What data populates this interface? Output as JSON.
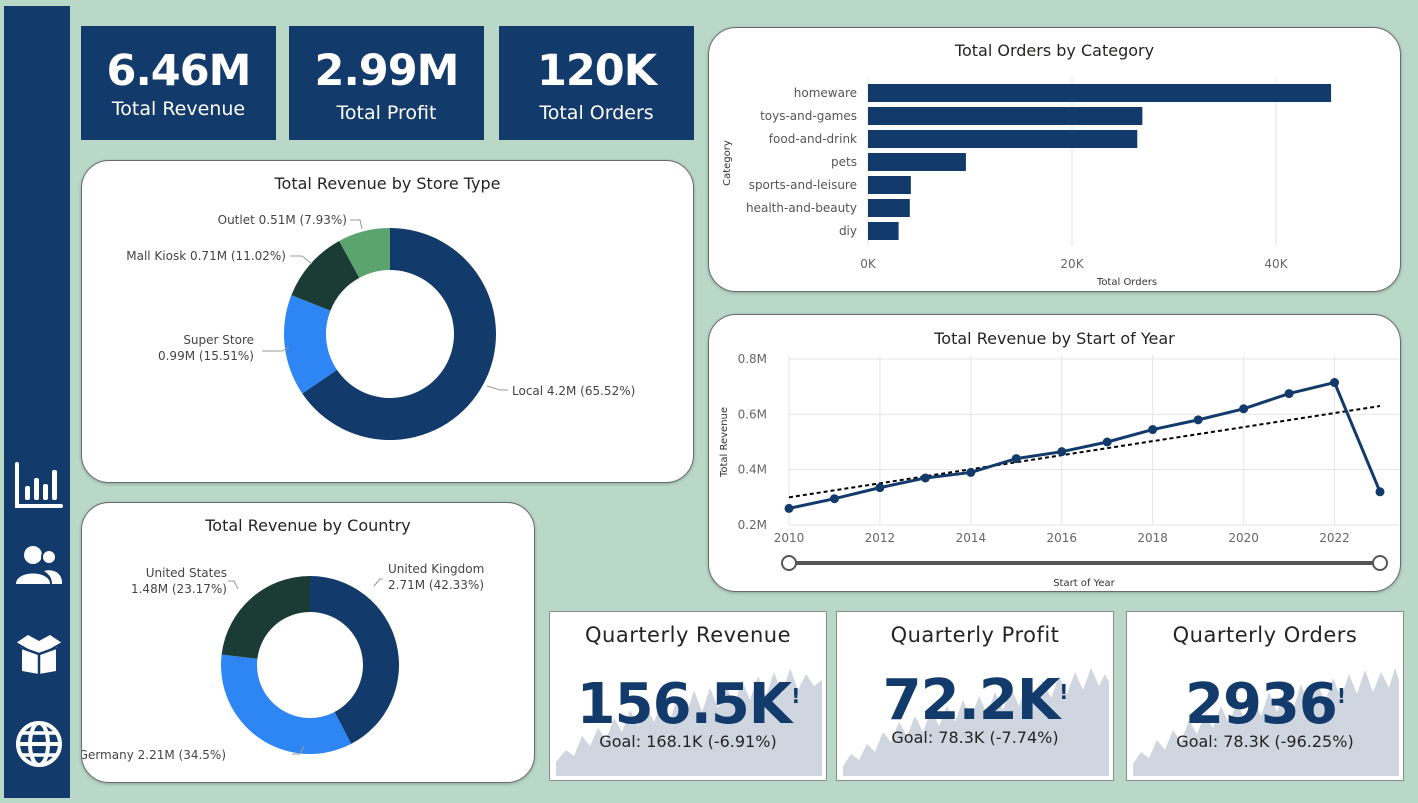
{
  "colors": {
    "background": "#b9d8c8",
    "navy": "#123a6a",
    "blue": "#2e86f5",
    "dark_green": "#1a3c34",
    "green": "#5ba36f",
    "sparkline": "#cfd6e0",
    "trendline": "#000000"
  },
  "sidebar": {
    "items": [
      {
        "icon": "bar-chart-icon"
      },
      {
        "icon": "users-icon"
      },
      {
        "icon": "box-icon"
      },
      {
        "icon": "globe-icon"
      }
    ]
  },
  "kpis": [
    {
      "value": "6.46M",
      "label": "Total Revenue"
    },
    {
      "value": "2.99M",
      "label": "Total Profit"
    },
    {
      "value": "120K",
      "label": "Total Orders"
    }
  ],
  "store_type_chart": {
    "title": "Total Revenue by Store Type"
  },
  "country_chart": {
    "title": "Total Revenue by Country"
  },
  "category_chart": {
    "title": "Total Orders by Category",
    "ylabel": "Category",
    "xlabel": "Total Orders",
    "ticks": [
      "0K",
      "20K",
      "40K"
    ]
  },
  "year_chart": {
    "title": "Total Revenue by Start of Year",
    "ylabel": "Total Revenue",
    "xlabel": "Start of Year",
    "yticks": [
      "0.8M",
      "0.6M",
      "0.4M",
      "0.2M"
    ],
    "xticks": [
      "2010",
      "2012",
      "2014",
      "2016",
      "2018",
      "2020",
      "2022"
    ]
  },
  "quarterly": [
    {
      "title": "Quarterly Revenue",
      "value": "156.5K",
      "marker": "!",
      "goal": "Goal: 168.1K (-6.91%)"
    },
    {
      "title": "Quarterly Profit",
      "value": "72.2K",
      "marker": "!",
      "goal": "Goal: 78.3K (-7.74%)"
    },
    {
      "title": "Quarterly Orders",
      "value": "2936",
      "marker": "!",
      "goal": "Goal: 78.3K (-96.25%)"
    }
  ],
  "chart_data": [
    {
      "type": "pie",
      "title": "Total Revenue by Store Type",
      "slices": [
        {
          "name": "Local",
          "value": 4.2,
          "percent": 65.52,
          "label": "Local 4.2M (65.52%)",
          "color": "#123a6a"
        },
        {
          "name": "Super Store",
          "value": 0.99,
          "percent": 15.51,
          "label_lines": [
            "Super Store",
            "0.99M (15.51%)"
          ],
          "color": "#2e86f5"
        },
        {
          "name": "Mall Kiosk",
          "value": 0.71,
          "percent": 11.02,
          "label": "Mall Kiosk 0.71M (11.02%)",
          "color": "#1a3c34"
        },
        {
          "name": "Outlet",
          "value": 0.51,
          "percent": 7.93,
          "label": "Outlet 0.51M (7.93%)",
          "color": "#5ba36f"
        }
      ]
    },
    {
      "type": "pie",
      "title": "Total Revenue by Country",
      "slices": [
        {
          "name": "United Kingdom",
          "value": 2.71,
          "percent": 42.33,
          "label_lines": [
            "United Kingdom",
            "2.71M (42.33%)"
          ],
          "color": "#123a6a"
        },
        {
          "name": "Germany",
          "value": 2.21,
          "percent": 34.5,
          "label": "Germany 2.21M (34.5%)",
          "color": "#2e86f5"
        },
        {
          "name": "United States",
          "value": 1.48,
          "percent": 23.17,
          "label_lines": [
            "United States",
            "1.48M (23.17%)"
          ],
          "color": "#1a3c34"
        }
      ]
    },
    {
      "type": "bar",
      "orientation": "horizontal",
      "title": "Total Orders by Category",
      "categories": [
        "homeware",
        "toys-and-games",
        "food-and-drink",
        "pets",
        "sports-and-leisure",
        "health-and-beauty",
        "diy"
      ],
      "values": [
        45400,
        26900,
        26400,
        9600,
        4200,
        4100,
        3000
      ],
      "xlabel": "Total Orders",
      "ylabel": "Category",
      "xlim": [
        0,
        50000
      ]
    },
    {
      "type": "line",
      "title": "Total Revenue by Start of Year",
      "x": [
        2010,
        2011,
        2012,
        2013,
        2014,
        2015,
        2016,
        2017,
        2018,
        2019,
        2020,
        2021,
        2022,
        2023
      ],
      "values": [
        0.26,
        0.295,
        0.335,
        0.37,
        0.39,
        0.44,
        0.465,
        0.5,
        0.545,
        0.58,
        0.62,
        0.675,
        0.715,
        0.32
      ],
      "trendline": {
        "from": [
          2010,
          0.3
        ],
        "to": [
          2023,
          0.63
        ],
        "style": "dashed"
      },
      "xlabel": "Start of Year",
      "ylabel": "Total Revenue",
      "ylim": [
        0.2,
        0.8
      ],
      "xlim": [
        2010,
        2023
      ],
      "grid": true
    }
  ]
}
